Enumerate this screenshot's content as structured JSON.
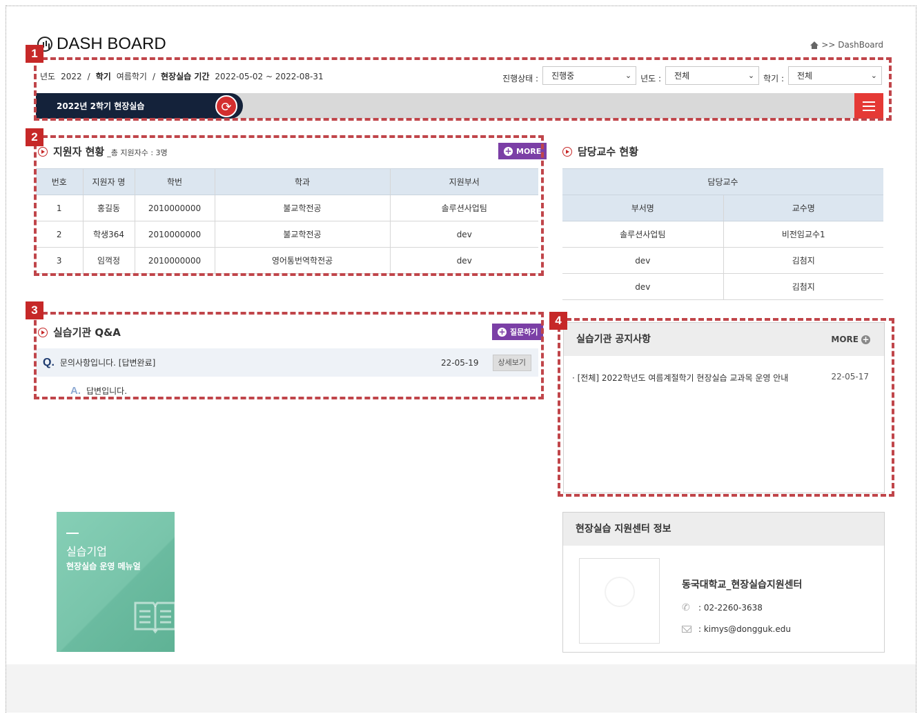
{
  "header": {
    "title": "DASH BOARD",
    "breadcrumb": ">> DashBoard"
  },
  "badges": [
    "1",
    "2",
    "3",
    "4"
  ],
  "info": {
    "year_label": "년도",
    "year": "2022",
    "sep": "/",
    "semester_label": "학기",
    "semester": "여름학기",
    "period_label": "현장실습 기간",
    "period": "2022-05-02 ~ 2022-08-31"
  },
  "filters": {
    "status_label": "진행상태 :",
    "status_value": "진행중",
    "year_label": "년도 :",
    "year_value": "전체",
    "semester_label": "학기 :",
    "semester_value": "전체"
  },
  "term_bar": {
    "current_term": "2022년 2학기 현장실습"
  },
  "applicants": {
    "title": "지원자 현황",
    "subtitle": "_총 지원자수 : 3명",
    "more": "MORE",
    "columns": [
      "번호",
      "지원자 명",
      "학번",
      "학과",
      "지원부서"
    ],
    "rows": [
      [
        "1",
        "홍길동",
        "2010000000",
        "불교학전공",
        "솔루션사업팀"
      ],
      [
        "2",
        "학생364",
        "2010000000",
        "불교학전공",
        "dev"
      ],
      [
        "3",
        "임꺽정",
        "2010000000",
        "영어통번역학전공",
        "dev"
      ]
    ]
  },
  "professors": {
    "title": "담당교수 현황",
    "group_header": "담당교수",
    "columns": [
      "부서명",
      "교수명"
    ],
    "rows": [
      [
        "솔루션사업팀",
        "비전임교수1"
      ],
      [
        "dev",
        "김첨지"
      ],
      [
        "dev",
        "김첨지"
      ]
    ]
  },
  "qna": {
    "title": "실습기관 Q&A",
    "ask_button": "질문하기",
    "q_mark": "Q.",
    "question": "문의사항입니다. [답변완료]",
    "date": "22-05-19",
    "detail_button": "상세보기",
    "a_mark": "A.",
    "answer": "답변입니다."
  },
  "notices": {
    "title": "실습기관 공지사항",
    "more": "MORE",
    "items": [
      {
        "text": "· [전체] 2022학년도 여름계절학기 현장실습 교과목 운영 안내",
        "date": "22-05-17"
      }
    ]
  },
  "manual": {
    "line1": "실습기업",
    "line2": "현장실습 운영 메뉴얼"
  },
  "center": {
    "title": "현장실습 지원센터 정보",
    "name": "동국대학교_현장실습지원센터",
    "phone": ": 02-2260-3638",
    "email": ": kimys@dongguk.edu"
  },
  "colors": {
    "accent_red": "#c62828",
    "navy": "#14223a",
    "purple": "#7b3fa6",
    "annotation": "#c0454a"
  }
}
